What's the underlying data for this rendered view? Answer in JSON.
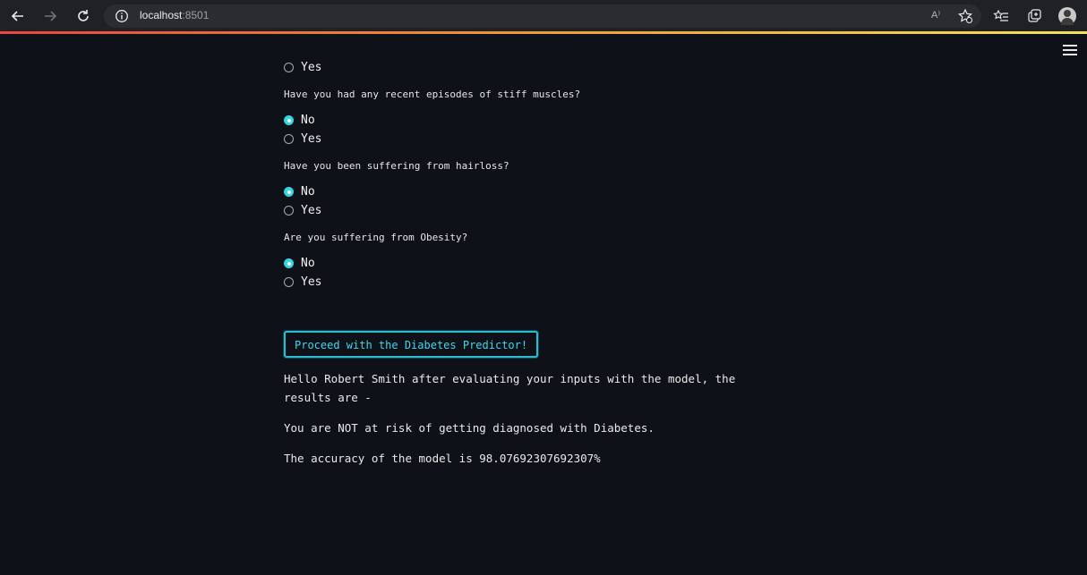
{
  "browser": {
    "url_host": "localhost",
    "url_port": ":8501",
    "read_aloud_label": "A⁾"
  },
  "form": {
    "partial_option": "Yes",
    "questions": [
      {
        "text": "Have you had any recent episodes of stiff muscles?",
        "options": [
          "No",
          "Yes"
        ],
        "selected": "No"
      },
      {
        "text": "Have you been suffering from hairloss?",
        "options": [
          "No",
          "Yes"
        ],
        "selected": "No"
      },
      {
        "text": "Are you suffering from Obesity?",
        "options": [
          "No",
          "Yes"
        ],
        "selected": "No"
      }
    ]
  },
  "predict_button_label": "Proceed with the Diabetes Predictor!",
  "results": {
    "greeting": "Hello Robert Smith after evaluating your inputs with the model, the results are -",
    "verdict": "You are NOT at risk of getting diagnosed with Diabetes.",
    "accuracy": "The accuracy of the model is 98.07692307692307%"
  },
  "colors": {
    "accent": "#37d4e6",
    "background": "#0e1117"
  }
}
